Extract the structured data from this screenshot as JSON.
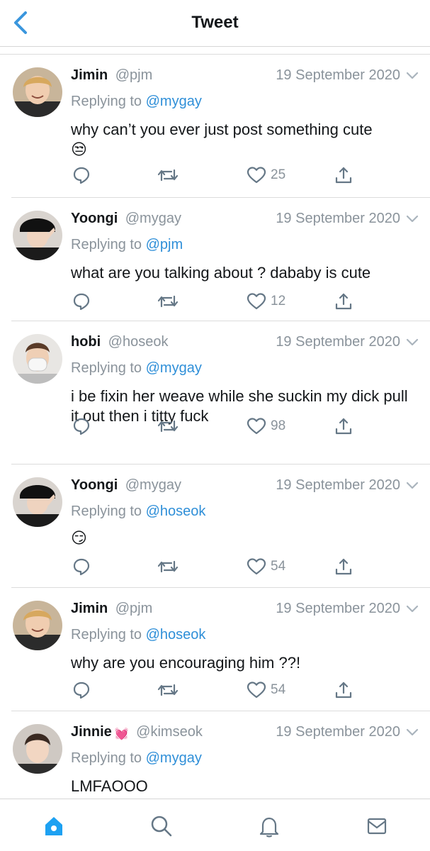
{
  "header": {
    "title": "Tweet"
  },
  "tweets": [
    {
      "name": "Jimin",
      "handle": "@pjm",
      "date": "19 September 2020",
      "replying_prefix": "Replying to",
      "replying_to": "@mygay",
      "text": "why can’t you ever just post something cute",
      "emoji": "😒",
      "likes": "25",
      "avatar": "jimin"
    },
    {
      "name": "Yoongi",
      "handle": "@mygay",
      "date": "19 September 2020",
      "replying_prefix": "Replying to",
      "replying_to": "@pjm",
      "text": "what are you talking about ? dababy is cute",
      "emoji": "",
      "likes": "12",
      "avatar": "yoongi"
    },
    {
      "name": "hobi",
      "handle": "@hoseok",
      "date": "19 September 2020",
      "replying_prefix": "Replying to",
      "replying_to": "@mygay",
      "text": "i be fixin her weave while she suckin my dick pull it out then i titty fuck",
      "emoji": "",
      "likes": "98",
      "avatar": "hobi"
    },
    {
      "name": "Yoongi",
      "handle": "@mygay",
      "date": "19 September 2020",
      "replying_prefix": "Replying to",
      "replying_to": "@hoseok",
      "text": "",
      "emoji": "😏",
      "likes": "54",
      "avatar": "yoongi"
    },
    {
      "name": "Jimin",
      "handle": "@pjm",
      "date": "19 September 2020",
      "replying_prefix": "Replying to",
      "replying_to": "@hoseok",
      "text": "why are you encouraging him ??!",
      "emoji": "",
      "likes": "54",
      "avatar": "jimin"
    },
    {
      "name": "Jinnie",
      "name_badge": "💓",
      "handle": "@kimseok",
      "date": "19 September 2020",
      "replying_prefix": "Replying to",
      "replying_to": "@mygay",
      "text": "LMFAOOO",
      "emoji": "",
      "likes": "",
      "avatar": "jinnie"
    }
  ],
  "icons": {
    "back": "chevron-left-icon",
    "reply": "comment-icon",
    "retweet": "retweet-icon",
    "like": "heart-icon",
    "share": "share-icon",
    "more": "chevron-down-icon",
    "tab_home": "home-icon",
    "tab_search": "search-icon",
    "tab_notifications": "bell-icon",
    "tab_messages": "mail-icon"
  },
  "colors": {
    "accent": "#1da1f2",
    "mention": "#2f8fd8",
    "muted": "#8a939b",
    "text": "#14171a"
  }
}
